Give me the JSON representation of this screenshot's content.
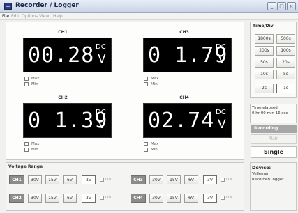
{
  "window": {
    "title": "Recorder / Logger",
    "min": "_",
    "max": "□",
    "close": "×"
  },
  "menu": {
    "items": [
      "File",
      "Edit",
      "Options",
      "View",
      "Help"
    ]
  },
  "channels": [
    {
      "label": "CH1",
      "value": "00.28",
      "coupling": "DC",
      "unit": "V",
      "max_label": "Max",
      "min_label": "Min"
    },
    {
      "label": "CH3",
      "value": "0 1.79",
      "coupling": "DC",
      "unit": "V",
      "max_label": "Max",
      "min_label": "Min"
    },
    {
      "label": "CH2",
      "value": "0 1.39",
      "coupling": "DC",
      "unit": "V",
      "max_label": "Max",
      "min_label": "Min"
    },
    {
      "label": "CH4",
      "value": "02.74",
      "coupling": "DC",
      "unit": "V",
      "max_label": "Max",
      "min_label": "Min"
    }
  ],
  "voltage_range": {
    "title": "Voltage Range",
    "rows": [
      {
        "chan": "CH1",
        "buttons": [
          "30V",
          "15V",
          "6V",
          "3V"
        ],
        "selected": "3V",
        "on_label": "ON"
      },
      {
        "chan": "CH3",
        "buttons": [
          "30V",
          "15V",
          "6V",
          "3V"
        ],
        "selected": "3V",
        "on_label": "ON"
      },
      {
        "chan": "CH2",
        "buttons": [
          "30V",
          "15V",
          "6V",
          "3V"
        ],
        "selected": "3V",
        "on_label": "ON"
      },
      {
        "chan": "CH4",
        "buttons": [
          "30V",
          "15V",
          "6V",
          "3V"
        ],
        "selected": "3V",
        "on_label": "ON"
      }
    ]
  },
  "time_div": {
    "title": "Time/Div",
    "buttons": [
      "1800s",
      "500s",
      "200s",
      "100s",
      "50s",
      "20s",
      "10s",
      "5s",
      "2s",
      "1s"
    ],
    "selected": "1s"
  },
  "status": {
    "time_elapsed_label": "Time elapsed",
    "time_elapsed_value": "0 hr 00 min 16 sec",
    "recording": "Recording",
    "plain_button": "Plain",
    "single_button": "Single"
  },
  "device": {
    "title": "Device:",
    "line1": "Velleman",
    "line2": "Recorder/Logger"
  },
  "colors": {
    "lcd_bg": "#000000",
    "lcd_fg": "#ffffff",
    "chan_button": "#8b8b8b",
    "recording_bar": "#a7a7a7"
  }
}
